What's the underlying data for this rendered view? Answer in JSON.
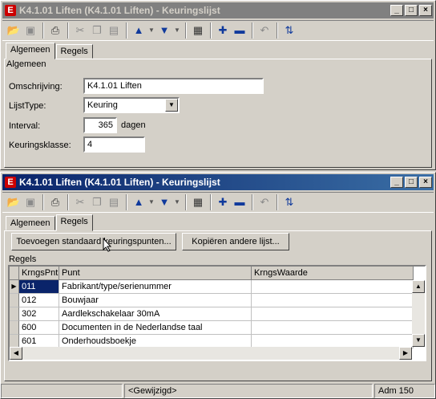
{
  "window_top": {
    "title": "K4.1.01 Liften (K4.1.01 Liften) - Keuringslijst",
    "app_icon_glyph": "E",
    "tabs": [
      "Algemeen",
      "Regels"
    ],
    "group_label": "Algemeen",
    "fields": {
      "omschrijving_label": "Omschrijving:",
      "omschrijving_value": "K4.1.01 Liften",
      "lijsttype_label": "LijstType:",
      "lijsttype_value": "Keuring",
      "interval_label": "Interval:",
      "interval_value": "365",
      "interval_unit": "dagen",
      "keuringsklasse_label": "Keuringsklasse:",
      "keuringsklasse_value": "4"
    }
  },
  "window_bottom": {
    "title": "K4.1.01 Liften (K4.1.01 Liften) - Keuringslijst",
    "app_icon_glyph": "E",
    "tabs": [
      "Algemeen",
      "Regels"
    ],
    "buttons": {
      "add_standard": "Toevoegen standaard keuringspunten...",
      "copy_other": "Kopiëren andere lijst..."
    },
    "group_label": "Regels",
    "grid": {
      "columns": [
        "KrngsPnt",
        "Punt",
        "KrngsWaarde"
      ],
      "rows": [
        {
          "krngspnt": "011",
          "punt": "Fabrikant/type/serienummer",
          "waarde": ""
        },
        {
          "krngspnt": "012",
          "punt": "Bouwjaar",
          "waarde": ""
        },
        {
          "krngspnt": "302",
          "punt": "Aardlekschakelaar 30mA",
          "waarde": ""
        },
        {
          "krngspnt": "600",
          "punt": "Documenten in de Nederlandse taal",
          "waarde": ""
        },
        {
          "krngspnt": "601",
          "punt": "Onderhoudsboekje",
          "waarde": ""
        }
      ]
    },
    "status": {
      "modified": "<Gewijzigd>",
      "user": "Adm 150"
    }
  },
  "icons": [
    "open-folder-icon",
    "save-icon",
    "print-icon",
    "cut-icon",
    "copy-icon",
    "paste-icon",
    "arrow-up-icon",
    "arrow-down-icon",
    "layout-icon",
    "plus-icon",
    "minus-icon",
    "undo-icon",
    "refresh-icon"
  ]
}
